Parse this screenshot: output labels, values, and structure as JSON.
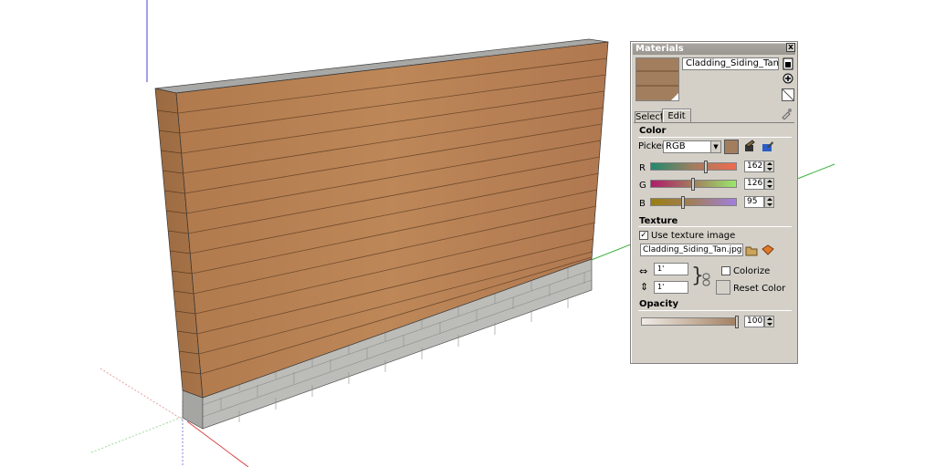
{
  "panel": {
    "title": "Materials",
    "close_label": "x",
    "material_name": "Cladding_Siding_Tan",
    "tabs": {
      "select": "Select",
      "edit": "Edit"
    },
    "color": {
      "heading": "Color",
      "picker_label": "Picker:",
      "picker_value": "RGB",
      "swatch_color": "#a27e5f",
      "r_label": "R",
      "r_value": "162",
      "r_fraction": 0.64,
      "g_label": "G",
      "g_value": "126",
      "g_fraction": 0.49,
      "b_label": "B",
      "b_value": "95",
      "b_fraction": 0.37
    },
    "texture": {
      "heading": "Texture",
      "use_texture_label": "Use texture image",
      "use_texture_checked": true,
      "file_name": "Cladding_Siding_Tan.jpg",
      "width_value": "1'",
      "height_value": "1'",
      "colorize_label": "Colorize",
      "colorize_checked": false,
      "reset_color_label": "Reset Color"
    },
    "opacity": {
      "heading": "Opacity",
      "value": "100",
      "fraction": 1.0
    },
    "icons": [
      "display-secondary-icon",
      "create-material-icon",
      "default-material-icon",
      "sample-paint-icon",
      "match-color-model-icon",
      "match-color-screen-icon",
      "browse-texture-icon",
      "edit-texture-icon",
      "lock-aspect-icon"
    ]
  },
  "scene": {
    "siding_color": "#b07a4f",
    "block_color": "#b9b9b6",
    "axis_red": "#d94040",
    "axis_green": "#3cb33c",
    "axis_blue": "#4040d9"
  }
}
